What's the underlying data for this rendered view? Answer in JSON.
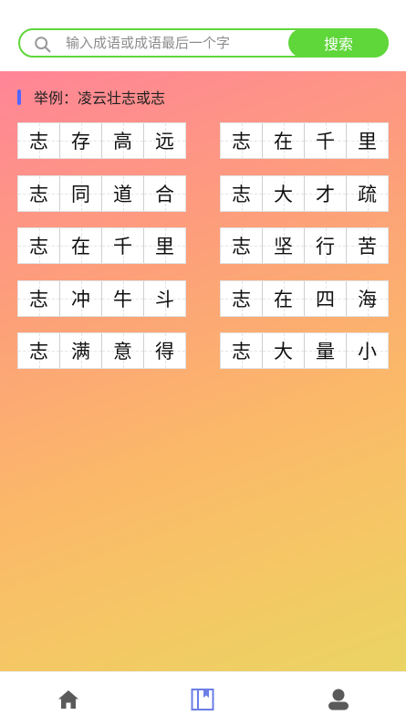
{
  "search": {
    "placeholder": "输入成语或成语最后一个字",
    "button_label": "搜索"
  },
  "example": {
    "text": "举例：凌云壮志或志"
  },
  "idioms": [
    [
      "志",
      "存",
      "高",
      "远"
    ],
    [
      "志",
      "在",
      "千",
      "里"
    ],
    [
      "志",
      "同",
      "道",
      "合"
    ],
    [
      "志",
      "大",
      "才",
      "疏"
    ],
    [
      "志",
      "在",
      "千",
      "里"
    ],
    [
      "志",
      "坚",
      "行",
      "苦"
    ],
    [
      "志",
      "冲",
      "牛",
      "斗"
    ],
    [
      "志",
      "在",
      "四",
      "海"
    ],
    [
      "志",
      "满",
      "意",
      "得"
    ],
    [
      "志",
      "大",
      "量",
      "小"
    ]
  ],
  "tabbar": {
    "items": [
      "home-icon",
      "book-icon",
      "user-icon"
    ],
    "active_index": 1,
    "colors": {
      "inactive": "#5a5a5a",
      "active": "#6b7ee6"
    }
  },
  "colors": {
    "accent_green": "#5fd63a",
    "example_bar": "#5265ff"
  }
}
